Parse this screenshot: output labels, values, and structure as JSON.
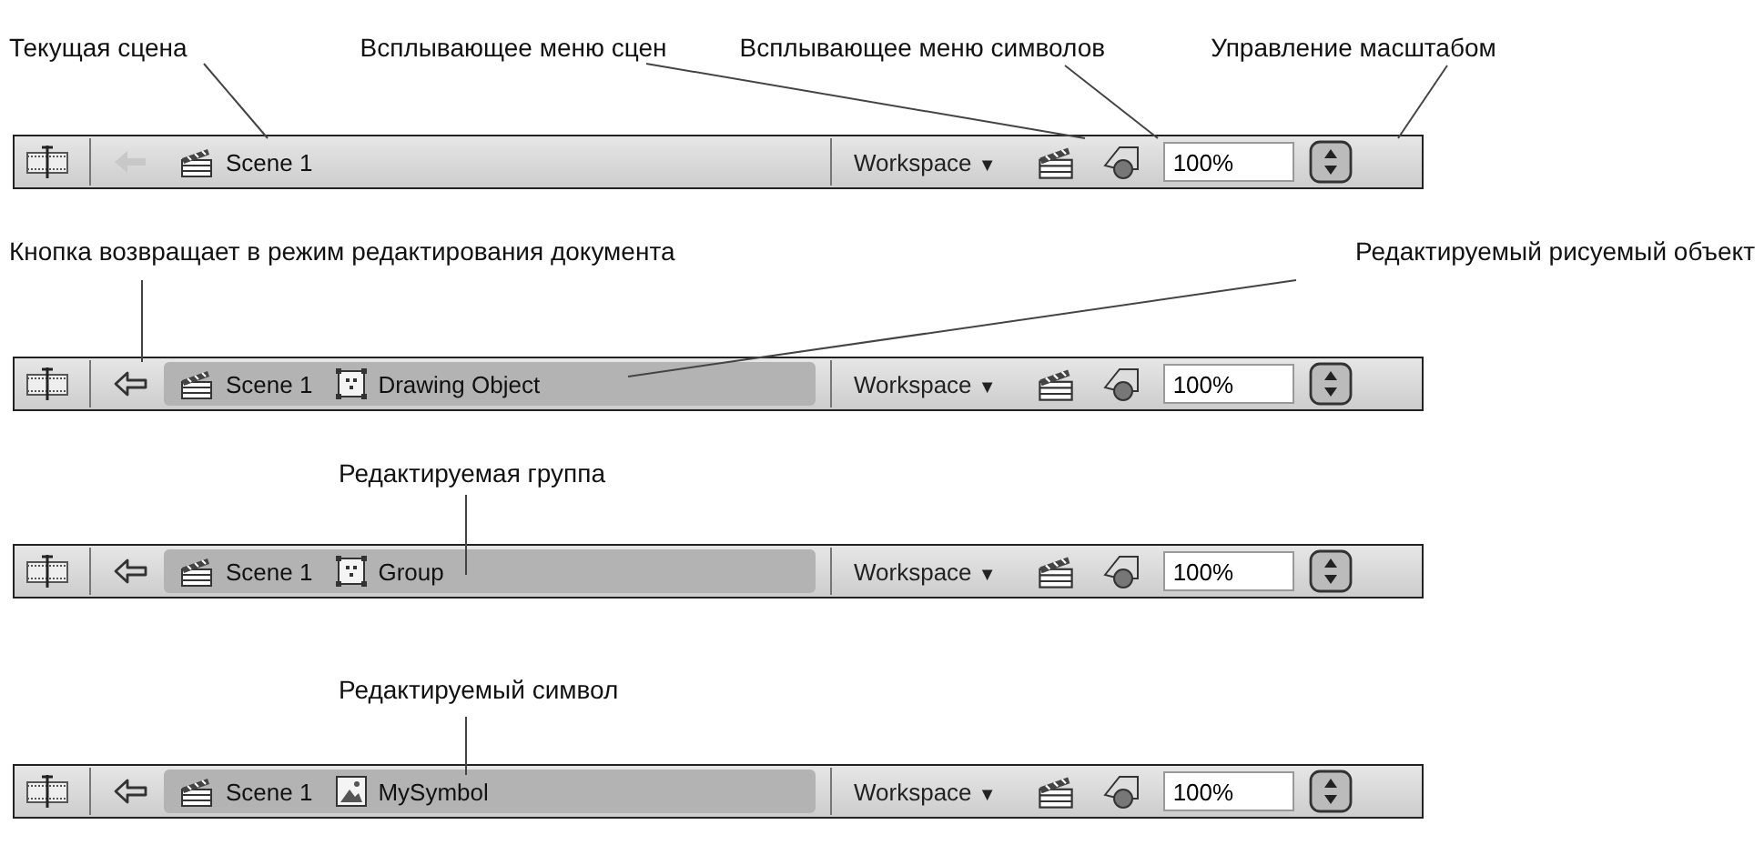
{
  "panels": [
    {
      "labels": [
        "Текущая сцена",
        "Всплывающее меню сцен",
        "Всплывающее меню символов",
        "Управление масштабом"
      ],
      "toolbar": {
        "back_button": {
          "disabled": true
        },
        "breadcrumbs": [
          {
            "kind": "scene",
            "label": "Scene 1"
          }
        ],
        "workspace_menu": {
          "label": "Workspace",
          "caret": "▼"
        },
        "zoom": "100%"
      }
    },
    {
      "labels": [
        "Кнопка возвращает в режим редактирования документа",
        "Редактируемый рисуемый объект"
      ],
      "toolbar": {
        "back_button": {
          "disabled": false
        },
        "breadcrumbs": [
          {
            "kind": "scene",
            "label": "Scene 1"
          },
          {
            "kind": "drawing-object",
            "label": "Drawing Object"
          }
        ],
        "workspace_menu": {
          "label": "Workspace",
          "caret": "▼"
        },
        "zoom": "100%"
      }
    },
    {
      "labels": [
        "Редактируемая группа"
      ],
      "toolbar": {
        "back_button": {
          "disabled": false
        },
        "breadcrumbs": [
          {
            "kind": "scene",
            "label": "Scene 1"
          },
          {
            "kind": "group",
            "label": "Group"
          }
        ],
        "workspace_menu": {
          "label": "Workspace",
          "caret": "▼"
        },
        "zoom": "100%"
      }
    },
    {
      "labels": [
        "Редактируемый символ"
      ],
      "toolbar": {
        "back_button": {
          "disabled": false
        },
        "breadcrumbs": [
          {
            "kind": "scene",
            "label": "Scene 1"
          },
          {
            "kind": "symbol",
            "label": "MySymbol"
          }
        ],
        "workspace_menu": {
          "label": "Workspace",
          "caret": "▼"
        },
        "zoom": "100%"
      }
    }
  ]
}
